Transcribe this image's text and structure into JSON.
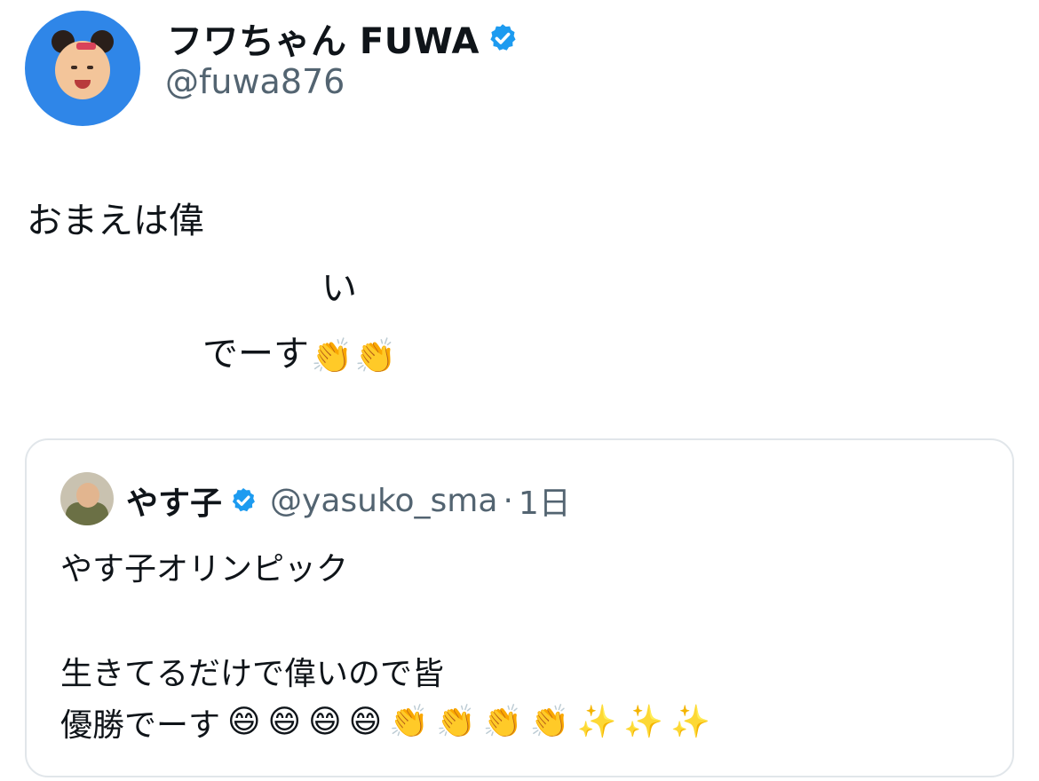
{
  "tweet": {
    "author": {
      "display_name": "フワちゃん FUWA",
      "handle": "@fuwa876",
      "verified_icon": "verified-badge-icon"
    },
    "text_lines": [
      "おまえは偉",
      "い",
      "でーす"
    ],
    "emojis": [
      "👏",
      "👏"
    ]
  },
  "quote": {
    "author": {
      "display_name": "やす子",
      "handle": "@yasuko_sma",
      "separator": "·",
      "time": "1日"
    },
    "text_lines": [
      "やす子オリンピック",
      "生きてるだけで偉いので皆",
      "優勝でーす"
    ],
    "emojis": [
      "😄",
      "😄",
      "😄",
      "😄",
      "👏",
      "👏",
      "👏",
      "👏",
      "✨",
      "✨",
      "✨"
    ]
  },
  "colors": {
    "verified": "#1d9bf0",
    "text": "#0f1419",
    "secondary": "#536471",
    "border": "#e1e6ea"
  }
}
